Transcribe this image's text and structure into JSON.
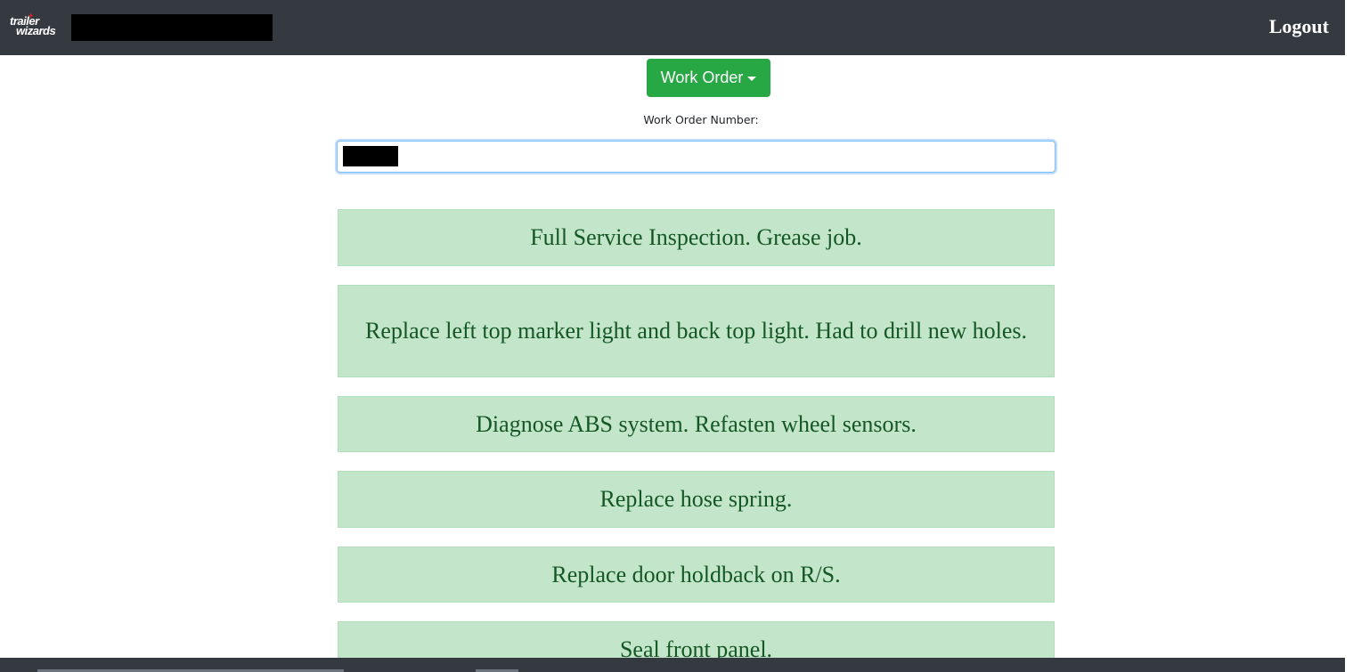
{
  "header": {
    "logo_line1": "trailer",
    "logo_line2": "wizards",
    "logout_label": "Logout"
  },
  "work_order_menu": {
    "label": "Work Order"
  },
  "work_order_field": {
    "label": "Work Order Number:"
  },
  "tasks": [
    "Full Service Inspection. Grease job.",
    "Replace left top marker light and back top light. Had to drill new holes.",
    "Diagnose ABS system. Refasten wheel sensors.",
    "Replace hose spring.",
    "Replace door holdback on R/S.",
    "Seal front panel."
  ],
  "colors": {
    "navbar": "#343a40",
    "button_green": "#28a745",
    "task_background": "#c3e6cb",
    "task_text": "#155724"
  }
}
